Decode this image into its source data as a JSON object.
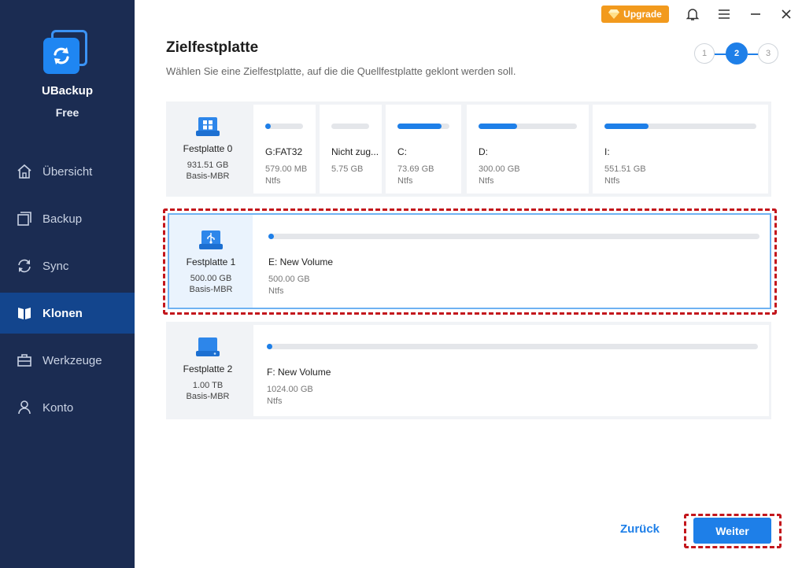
{
  "app": {
    "name": "UBackup",
    "edition": "Free"
  },
  "sidebar": {
    "items": [
      {
        "label": "Übersicht",
        "icon": "home-icon"
      },
      {
        "label": "Backup",
        "icon": "backup-icon"
      },
      {
        "label": "Sync",
        "icon": "sync-icon"
      },
      {
        "label": "Klonen",
        "icon": "clone-icon",
        "active": true
      },
      {
        "label": "Werkzeuge",
        "icon": "toolbox-icon"
      },
      {
        "label": "Konto",
        "icon": "user-icon"
      }
    ]
  },
  "titlebar": {
    "upgrade_label": "Upgrade"
  },
  "header": {
    "title": "Zielfestplatte",
    "subtitle": "Wählen Sie eine Zielfestplatte, auf die die Quellfestplatte geklont werden soll."
  },
  "stepper": {
    "steps": [
      "1",
      "2",
      "3"
    ],
    "current": 2
  },
  "disks": [
    {
      "name": "Festplatte 0",
      "size": "931.51 GB",
      "type": "Basis-MBR",
      "icon": "windows-disk-icon",
      "partitions": [
        {
          "label": "G:FAT32",
          "size": "579.00 MB",
          "fs": "Ntfs",
          "used_fraction": 0.12
        },
        {
          "label": "Nicht zug...",
          "size": "5.75 GB",
          "fs": "",
          "used_fraction": 0
        },
        {
          "label": "C:",
          "size": "73.69 GB",
          "fs": "Ntfs",
          "used_fraction": 0.85
        },
        {
          "label": "D:",
          "size": "300.00 GB",
          "fs": "Ntfs",
          "used_fraction": 0.39
        },
        {
          "label": "I:",
          "size": "551.51 GB",
          "fs": "Ntfs",
          "used_fraction": 0.29
        }
      ]
    },
    {
      "name": "Festplatte 1",
      "size": "500.00 GB",
      "type": "Basis-MBR",
      "icon": "usb-disk-icon",
      "selected": true,
      "partitions": [
        {
          "label": "E: New Volume",
          "size": "500.00 GB",
          "fs": "Ntfs",
          "used_fraction": 0.005
        }
      ]
    },
    {
      "name": "Festplatte 2",
      "size": "1.00 TB",
      "type": "Basis-MBR",
      "icon": "disk-icon",
      "partitions": [
        {
          "label": "F: New Volume",
          "size": "1024.00 GB",
          "fs": "Ntfs",
          "used_fraction": 0.005
        }
      ]
    }
  ],
  "footer": {
    "back_label": "Zurück",
    "next_label": "Weiter"
  },
  "colors": {
    "sidebar_bg": "#1b2c52",
    "sidebar_active": "#13458d",
    "accent": "#1e7fe8",
    "upgrade": "#f29a1d",
    "highlight_dash": "#c3161c"
  }
}
